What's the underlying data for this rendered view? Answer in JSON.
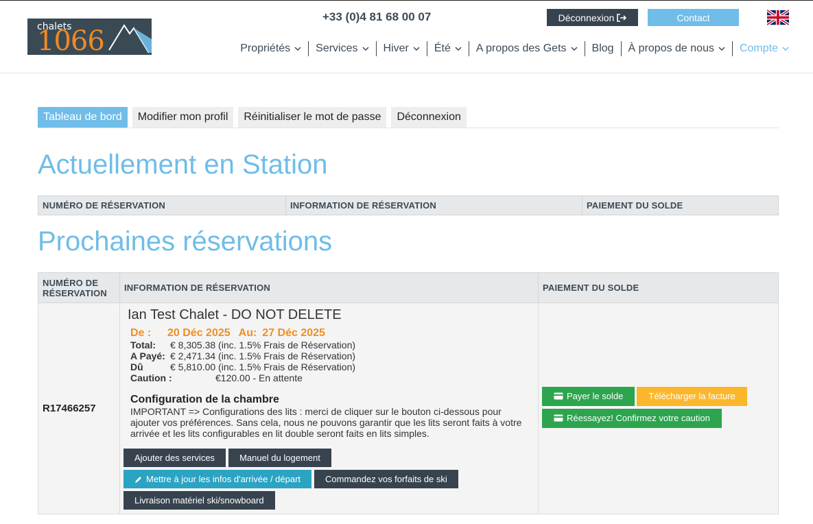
{
  "header": {
    "logo_small": "chalets",
    "logo_big": "1066",
    "phone": "+33 (0)4 81 68 00 07",
    "logout_label": "Déconnexion",
    "contact_label": "Contact",
    "flag_icon": "uk-flag-icon",
    "nav": [
      {
        "label": "Propriétés",
        "dropdown": true
      },
      {
        "label": "Services",
        "dropdown": true
      },
      {
        "label": "Hiver",
        "dropdown": true
      },
      {
        "label": "Été",
        "dropdown": true
      },
      {
        "label": "A propos des Gets",
        "dropdown": true
      },
      {
        "label": "Blog",
        "dropdown": false
      },
      {
        "label": "À propos de nous",
        "dropdown": true
      },
      {
        "label": "Compte",
        "dropdown": true,
        "active": true
      }
    ]
  },
  "tabs": [
    "Tableau de bord",
    "Modifier mon profil",
    "Réinitialiser le mot de passe",
    "Déconnexion"
  ],
  "current": {
    "title": "Actuellement en Station",
    "headers": [
      "NUMÉRO DE RÉSERVATION",
      "INFORMATION DE RÉSERVATION",
      "PAIEMENT DU SOLDE"
    ]
  },
  "upcoming": {
    "title": "Prochaines réservations",
    "headers": [
      "NUMÉRO DE RÉSERVATION",
      "INFORMATION DE RÉSERVATION",
      "PAIEMENT DU SOLDE"
    ],
    "booking": {
      "number": "R17466257",
      "chalet": "Ian Test Chalet - DO NOT DELETE",
      "from_label": "De :",
      "from_date": "20 Déc 2025",
      "to_label": "Au:",
      "to_date": "27 Déc 2025",
      "total_label": "Total:",
      "total_value": "€ 8,305.38 (inc. 1.5% Frais de Réservation)",
      "paid_label": "A Payé:",
      "paid_value": "€ 2,471.34 (inc. 1.5% Frais de Réservation)",
      "due_label": "Dû",
      "due_value": "€ 5,810.00 (inc. 1.5% Frais de Réservation)",
      "deposit_label": "Caution :",
      "deposit_value": "€120.00 - En attente",
      "config_title": "Configuration de la chambre",
      "config_text": "IMPORTANT => Configurations des lits : merci de cliquer sur le bouton ci-dessous pour ajouter vos préférences. Sans cela, nous ne pouvons garantir que les lits seront faits à votre arrivée et les lits configurables en lit double seront faits en lits simples.",
      "actions": {
        "add_services": "Ajouter des services",
        "manual": "Manuel du logement",
        "update_arrival": "Mettre à jour les infos d'arrivée / départ",
        "ski_pass": "Commandez vos forfaits de ski",
        "ski_delivery": "Livraison matériel ski/snowboard"
      },
      "payment": {
        "pay_balance": "Payer le solde",
        "download_invoice": "Télécharger la facture",
        "retry_deposit": "Réessayez! Confirmez votre caution"
      }
    }
  },
  "colors": {
    "accent": "#6fbde8",
    "dark": "#37434f",
    "orange": "#f28e1e",
    "green": "#2da44e",
    "yellow": "#fbb72c",
    "teal": "#2ba3c3"
  }
}
